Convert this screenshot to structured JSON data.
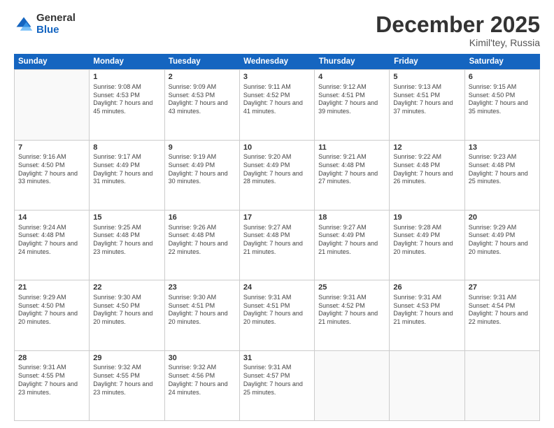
{
  "logo": {
    "general": "General",
    "blue": "Blue"
  },
  "title": "December 2025",
  "subtitle": "Kimil'tey, Russia",
  "header_days": [
    "Sunday",
    "Monday",
    "Tuesday",
    "Wednesday",
    "Thursday",
    "Friday",
    "Saturday"
  ],
  "weeks": [
    [
      {
        "day": "",
        "sunrise": "",
        "sunset": "",
        "daylight": ""
      },
      {
        "day": "1",
        "sunrise": "Sunrise: 9:08 AM",
        "sunset": "Sunset: 4:53 PM",
        "daylight": "Daylight: 7 hours and 45 minutes."
      },
      {
        "day": "2",
        "sunrise": "Sunrise: 9:09 AM",
        "sunset": "Sunset: 4:53 PM",
        "daylight": "Daylight: 7 hours and 43 minutes."
      },
      {
        "day": "3",
        "sunrise": "Sunrise: 9:11 AM",
        "sunset": "Sunset: 4:52 PM",
        "daylight": "Daylight: 7 hours and 41 minutes."
      },
      {
        "day": "4",
        "sunrise": "Sunrise: 9:12 AM",
        "sunset": "Sunset: 4:51 PM",
        "daylight": "Daylight: 7 hours and 39 minutes."
      },
      {
        "day": "5",
        "sunrise": "Sunrise: 9:13 AM",
        "sunset": "Sunset: 4:51 PM",
        "daylight": "Daylight: 7 hours and 37 minutes."
      },
      {
        "day": "6",
        "sunrise": "Sunrise: 9:15 AM",
        "sunset": "Sunset: 4:50 PM",
        "daylight": "Daylight: 7 hours and 35 minutes."
      }
    ],
    [
      {
        "day": "7",
        "sunrise": "Sunrise: 9:16 AM",
        "sunset": "Sunset: 4:50 PM",
        "daylight": "Daylight: 7 hours and 33 minutes."
      },
      {
        "day": "8",
        "sunrise": "Sunrise: 9:17 AM",
        "sunset": "Sunset: 4:49 PM",
        "daylight": "Daylight: 7 hours and 31 minutes."
      },
      {
        "day": "9",
        "sunrise": "Sunrise: 9:19 AM",
        "sunset": "Sunset: 4:49 PM",
        "daylight": "Daylight: 7 hours and 30 minutes."
      },
      {
        "day": "10",
        "sunrise": "Sunrise: 9:20 AM",
        "sunset": "Sunset: 4:49 PM",
        "daylight": "Daylight: 7 hours and 28 minutes."
      },
      {
        "day": "11",
        "sunrise": "Sunrise: 9:21 AM",
        "sunset": "Sunset: 4:48 PM",
        "daylight": "Daylight: 7 hours and 27 minutes."
      },
      {
        "day": "12",
        "sunrise": "Sunrise: 9:22 AM",
        "sunset": "Sunset: 4:48 PM",
        "daylight": "Daylight: 7 hours and 26 minutes."
      },
      {
        "day": "13",
        "sunrise": "Sunrise: 9:23 AM",
        "sunset": "Sunset: 4:48 PM",
        "daylight": "Daylight: 7 hours and 25 minutes."
      }
    ],
    [
      {
        "day": "14",
        "sunrise": "Sunrise: 9:24 AM",
        "sunset": "Sunset: 4:48 PM",
        "daylight": "Daylight: 7 hours and 24 minutes."
      },
      {
        "day": "15",
        "sunrise": "Sunrise: 9:25 AM",
        "sunset": "Sunset: 4:48 PM",
        "daylight": "Daylight: 7 hours and 23 minutes."
      },
      {
        "day": "16",
        "sunrise": "Sunrise: 9:26 AM",
        "sunset": "Sunset: 4:48 PM",
        "daylight": "Daylight: 7 hours and 22 minutes."
      },
      {
        "day": "17",
        "sunrise": "Sunrise: 9:27 AM",
        "sunset": "Sunset: 4:48 PM",
        "daylight": "Daylight: 7 hours and 21 minutes."
      },
      {
        "day": "18",
        "sunrise": "Sunrise: 9:27 AM",
        "sunset": "Sunset: 4:49 PM",
        "daylight": "Daylight: 7 hours and 21 minutes."
      },
      {
        "day": "19",
        "sunrise": "Sunrise: 9:28 AM",
        "sunset": "Sunset: 4:49 PM",
        "daylight": "Daylight: 7 hours and 20 minutes."
      },
      {
        "day": "20",
        "sunrise": "Sunrise: 9:29 AM",
        "sunset": "Sunset: 4:49 PM",
        "daylight": "Daylight: 7 hours and 20 minutes."
      }
    ],
    [
      {
        "day": "21",
        "sunrise": "Sunrise: 9:29 AM",
        "sunset": "Sunset: 4:50 PM",
        "daylight": "Daylight: 7 hours and 20 minutes."
      },
      {
        "day": "22",
        "sunrise": "Sunrise: 9:30 AM",
        "sunset": "Sunset: 4:50 PM",
        "daylight": "Daylight: 7 hours and 20 minutes."
      },
      {
        "day": "23",
        "sunrise": "Sunrise: 9:30 AM",
        "sunset": "Sunset: 4:51 PM",
        "daylight": "Daylight: 7 hours and 20 minutes."
      },
      {
        "day": "24",
        "sunrise": "Sunrise: 9:31 AM",
        "sunset": "Sunset: 4:51 PM",
        "daylight": "Daylight: 7 hours and 20 minutes."
      },
      {
        "day": "25",
        "sunrise": "Sunrise: 9:31 AM",
        "sunset": "Sunset: 4:52 PM",
        "daylight": "Daylight: 7 hours and 21 minutes."
      },
      {
        "day": "26",
        "sunrise": "Sunrise: 9:31 AM",
        "sunset": "Sunset: 4:53 PM",
        "daylight": "Daylight: 7 hours and 21 minutes."
      },
      {
        "day": "27",
        "sunrise": "Sunrise: 9:31 AM",
        "sunset": "Sunset: 4:54 PM",
        "daylight": "Daylight: 7 hours and 22 minutes."
      }
    ],
    [
      {
        "day": "28",
        "sunrise": "Sunrise: 9:31 AM",
        "sunset": "Sunset: 4:55 PM",
        "daylight": "Daylight: 7 hours and 23 minutes."
      },
      {
        "day": "29",
        "sunrise": "Sunrise: 9:32 AM",
        "sunset": "Sunset: 4:55 PM",
        "daylight": "Daylight: 7 hours and 23 minutes."
      },
      {
        "day": "30",
        "sunrise": "Sunrise: 9:32 AM",
        "sunset": "Sunset: 4:56 PM",
        "daylight": "Daylight: 7 hours and 24 minutes."
      },
      {
        "day": "31",
        "sunrise": "Sunrise: 9:31 AM",
        "sunset": "Sunset: 4:57 PM",
        "daylight": "Daylight: 7 hours and 25 minutes."
      },
      {
        "day": "",
        "sunrise": "",
        "sunset": "",
        "daylight": ""
      },
      {
        "day": "",
        "sunrise": "",
        "sunset": "",
        "daylight": ""
      },
      {
        "day": "",
        "sunrise": "",
        "sunset": "",
        "daylight": ""
      }
    ]
  ]
}
